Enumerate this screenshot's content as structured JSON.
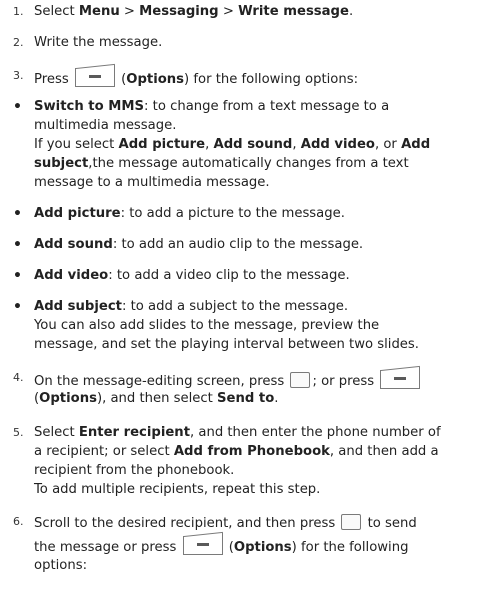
{
  "steps": [
    {
      "num": "1.",
      "t1": "Select ",
      "b1": "Menu",
      "t2": " > ",
      "b2": "Messaging",
      "t3": " > ",
      "b3": "Write message",
      "t4": "."
    },
    {
      "num": "2.",
      "text": "Write the message."
    },
    {
      "num": "3.",
      "t1": "Press ",
      "t2": " (",
      "b1": "Options",
      "t3": ") for the following options:"
    }
  ],
  "options": {
    "switch_mms": {
      "bold": "Switch to MMS",
      "rest": ": to change from a text message to a",
      "line2": "multimedia message."
    },
    "switch_note": {
      "t1": "If you select ",
      "b1": "Add picture",
      "t2": ", ",
      "b2": "Add sound",
      "t3": ", ",
      "b3": "Add video",
      "t4": ", or ",
      "b4": "Add",
      "b5": "subject",
      "t5": ",the message automatically changes from a text",
      "line3": "message to a multimedia message."
    },
    "add_picture": {
      "bold": "Add picture",
      "rest": ": to add a picture to the message."
    },
    "add_sound": {
      "bold": "Add sound",
      "rest": ": to add an audio clip to the message."
    },
    "add_video": {
      "bold": "Add video",
      "rest": ": to add a video clip to the message."
    },
    "add_subject": {
      "bold": "Add subject",
      "rest": ": to add a subject to the message.",
      "line2": "You can also add slides to the message, preview the",
      "line3": "message, and set the playing interval between two slides."
    }
  },
  "step4": {
    "num": "4.",
    "t1": "On the message-editing screen, press ",
    "t2": "; or press ",
    "t3": "(",
    "b1": "Options",
    "t4": "), and then select ",
    "b2": "Send to",
    "t5": "."
  },
  "step5": {
    "num": "5.",
    "t1": "Select ",
    "b1": "Enter recipient",
    "t2": ", and then enter the phone number of",
    "t3": "a recipient; or select ",
    "b2": "Add from Phonebook",
    "t4": ", and then add a",
    "line3": "recipient from the phonebook.",
    "line4": "To add multiple recipients, repeat this step."
  },
  "step6": {
    "num": "6.",
    "t1": "Scroll to the desired recipient, and then press ",
    "t2": " to send",
    "t3": "the message or press ",
    "t4": " (",
    "b1": "Options",
    "t5": ") for the following",
    "line3": "options:"
  },
  "icons": {
    "soft_key": "options-soft-key-icon",
    "center_key": "center-key-icon"
  }
}
